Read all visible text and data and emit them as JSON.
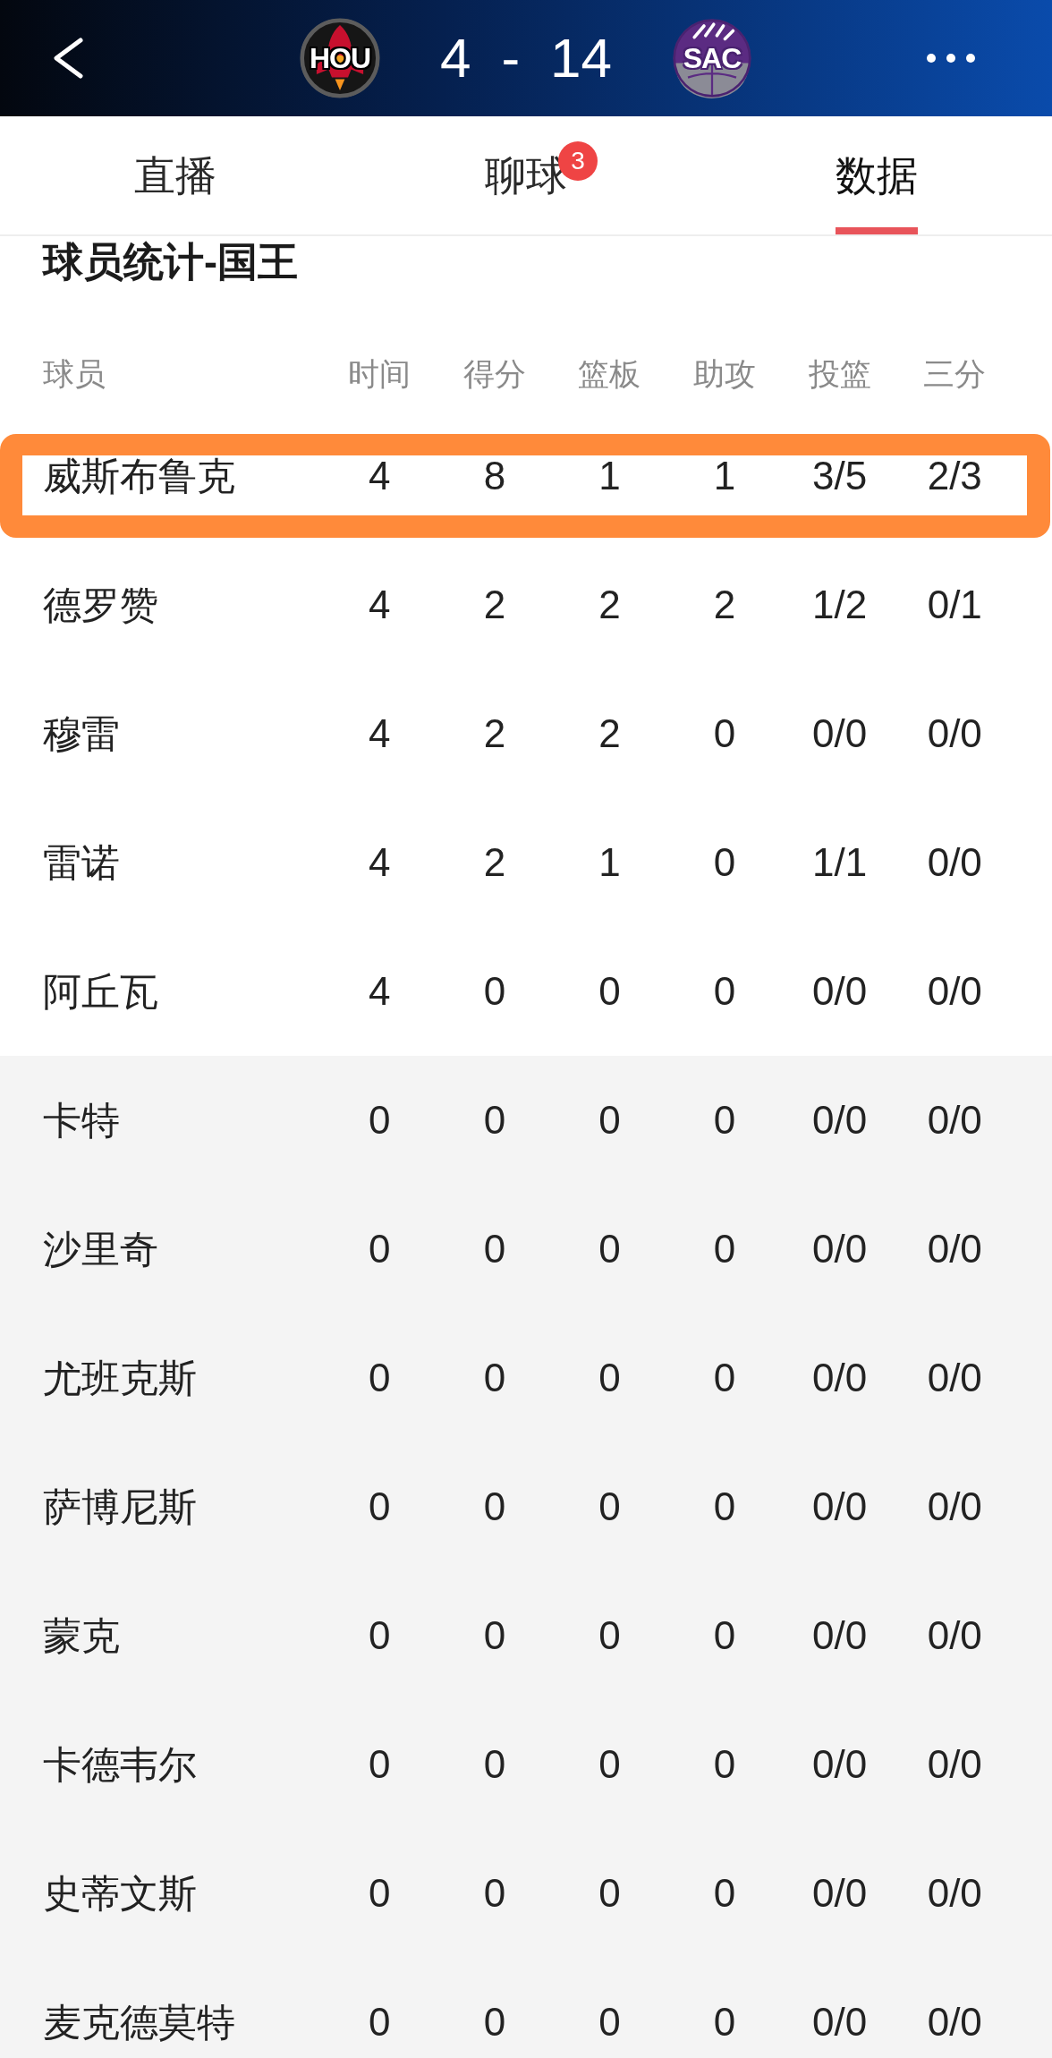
{
  "header": {
    "home_team": {
      "abbr": "HOU"
    },
    "home_score": "4",
    "separator": "-",
    "away_score": "14",
    "away_team": {
      "abbr": "SAC"
    }
  },
  "tabs": [
    {
      "label": "直播",
      "selected": false
    },
    {
      "label": "聊球",
      "selected": false,
      "badge": "3"
    },
    {
      "label": "数据",
      "selected": true
    }
  ],
  "section": {
    "title": "球员统计-国王",
    "columns": [
      "球员",
      "时间",
      "得分",
      "篮板",
      "助攻",
      "投篮",
      "三分"
    ],
    "players": [
      {
        "name": "威斯布鲁克",
        "stats": [
          "4",
          "8",
          "1",
          "1",
          "3/5",
          "2/3"
        ],
        "starter": true,
        "highlighted": true
      },
      {
        "name": "德罗赞",
        "stats": [
          "4",
          "2",
          "2",
          "2",
          "1/2",
          "0/1"
        ],
        "starter": true,
        "highlighted": false
      },
      {
        "name": "穆雷",
        "stats": [
          "4",
          "2",
          "2",
          "0",
          "0/0",
          "0/0"
        ],
        "starter": true,
        "highlighted": false
      },
      {
        "name": "雷诺",
        "stats": [
          "4",
          "2",
          "1",
          "0",
          "1/1",
          "0/0"
        ],
        "starter": true,
        "highlighted": false
      },
      {
        "name": "阿丘瓦",
        "stats": [
          "4",
          "0",
          "0",
          "0",
          "0/0",
          "0/0"
        ],
        "starter": true,
        "highlighted": false
      },
      {
        "name": "卡特",
        "stats": [
          "0",
          "0",
          "0",
          "0",
          "0/0",
          "0/0"
        ],
        "starter": false,
        "highlighted": false
      },
      {
        "name": "沙里奇",
        "stats": [
          "0",
          "0",
          "0",
          "0",
          "0/0",
          "0/0"
        ],
        "starter": false,
        "highlighted": false
      },
      {
        "name": "尤班克斯",
        "stats": [
          "0",
          "0",
          "0",
          "0",
          "0/0",
          "0/0"
        ],
        "starter": false,
        "highlighted": false
      },
      {
        "name": "萨博尼斯",
        "stats": [
          "0",
          "0",
          "0",
          "0",
          "0/0",
          "0/0"
        ],
        "starter": false,
        "highlighted": false
      },
      {
        "name": "蒙克",
        "stats": [
          "0",
          "0",
          "0",
          "0",
          "0/0",
          "0/0"
        ],
        "starter": false,
        "highlighted": false
      },
      {
        "name": "卡德韦尔",
        "stats": [
          "0",
          "0",
          "0",
          "0",
          "0/0",
          "0/0"
        ],
        "starter": false,
        "highlighted": false
      },
      {
        "name": "史蒂文斯",
        "stats": [
          "0",
          "0",
          "0",
          "0",
          "0/0",
          "0/0"
        ],
        "starter": false,
        "highlighted": false
      },
      {
        "name": "麦克德莫特",
        "stats": [
          "0",
          "0",
          "0",
          "0",
          "0/0",
          "0/0"
        ],
        "starter": false,
        "highlighted": false
      }
    ]
  }
}
